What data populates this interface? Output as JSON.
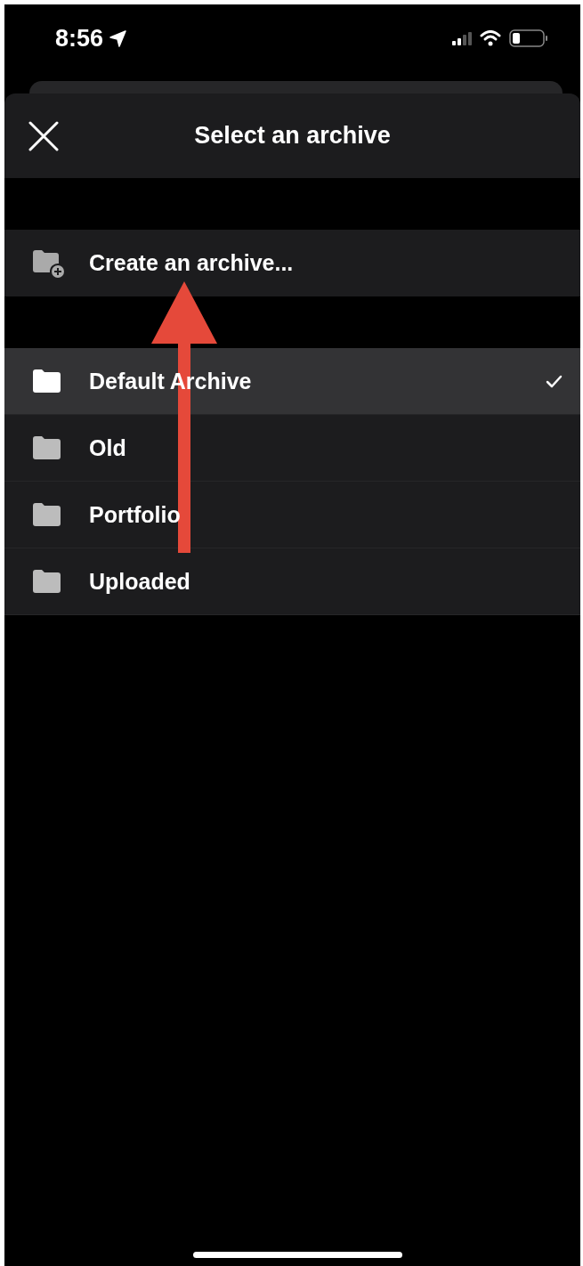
{
  "status_bar": {
    "time": "8:56"
  },
  "sheet": {
    "title": "Select an archive"
  },
  "create_action": {
    "label": "Create an archive..."
  },
  "archives": [
    {
      "label": "Default Archive",
      "selected": true
    },
    {
      "label": "Old",
      "selected": false
    },
    {
      "label": "Portfolio",
      "selected": false
    },
    {
      "label": "Uploaded",
      "selected": false
    }
  ]
}
